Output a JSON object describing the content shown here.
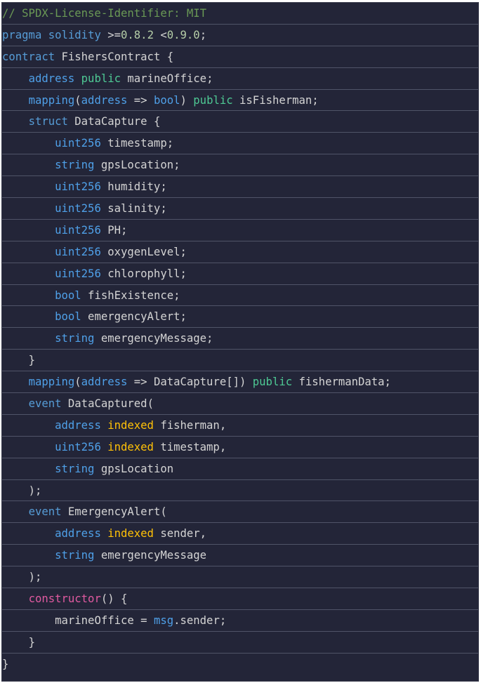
{
  "colors": {
    "background": "#232538",
    "line_separator": "#505468",
    "default": "#d4d4d4",
    "comment": "#6a9955",
    "keyword": "#569cd6",
    "type": "#4fa0e8",
    "modifier": "#4ec994",
    "indexed": "#ffc107",
    "number": "#b5cea8",
    "function": "#e05aa0"
  },
  "code": {
    "lines": [
      {
        "indent": "",
        "tokens": [
          {
            "t": "// SPDX-License-Identifier: MIT",
            "c": "comment"
          }
        ]
      },
      {
        "indent": "",
        "tokens": [
          {
            "t": "pragma",
            "c": "keyword"
          },
          {
            "t": " "
          },
          {
            "t": "solidity",
            "c": "keyword"
          },
          {
            "t": " >="
          },
          {
            "t": "0.8.2",
            "c": "number"
          },
          {
            "t": " <"
          },
          {
            "t": "0.9.0",
            "c": "number"
          },
          {
            "t": ";"
          }
        ]
      },
      {
        "indent": "",
        "tokens": [
          {
            "t": "contract",
            "c": "keyword"
          },
          {
            "t": " FishersContract {"
          }
        ]
      },
      {
        "indent": "    ",
        "tokens": [
          {
            "t": "address",
            "c": "type"
          },
          {
            "t": " "
          },
          {
            "t": "public",
            "c": "modifier"
          },
          {
            "t": " marineOffice;"
          }
        ]
      },
      {
        "indent": "    ",
        "tokens": [
          {
            "t": "mapping",
            "c": "type"
          },
          {
            "t": "("
          },
          {
            "t": "address",
            "c": "type"
          },
          {
            "t": " => "
          },
          {
            "t": "bool",
            "c": "type"
          },
          {
            "t": ") "
          },
          {
            "t": "public",
            "c": "modifier"
          },
          {
            "t": " isFisherman;"
          }
        ]
      },
      {
        "indent": "    ",
        "tokens": [
          {
            "t": "struct",
            "c": "keyword"
          },
          {
            "t": " DataCapture {"
          }
        ]
      },
      {
        "indent": "        ",
        "tokens": [
          {
            "t": "uint256",
            "c": "type"
          },
          {
            "t": " timestamp;"
          }
        ]
      },
      {
        "indent": "        ",
        "tokens": [
          {
            "t": "string",
            "c": "type"
          },
          {
            "t": " gpsLocation;"
          }
        ]
      },
      {
        "indent": "        ",
        "tokens": [
          {
            "t": "uint256",
            "c": "type"
          },
          {
            "t": " humidity;"
          }
        ]
      },
      {
        "indent": "        ",
        "tokens": [
          {
            "t": "uint256",
            "c": "type"
          },
          {
            "t": " salinity;"
          }
        ]
      },
      {
        "indent": "        ",
        "tokens": [
          {
            "t": "uint256",
            "c": "type"
          },
          {
            "t": " PH;"
          }
        ]
      },
      {
        "indent": "        ",
        "tokens": [
          {
            "t": "uint256",
            "c": "type"
          },
          {
            "t": " oxygenLevel;"
          }
        ]
      },
      {
        "indent": "        ",
        "tokens": [
          {
            "t": "uint256",
            "c": "type"
          },
          {
            "t": " chlorophyll;"
          }
        ]
      },
      {
        "indent": "        ",
        "tokens": [
          {
            "t": "bool",
            "c": "type"
          },
          {
            "t": " fishExistence;"
          }
        ]
      },
      {
        "indent": "        ",
        "tokens": [
          {
            "t": "bool",
            "c": "type"
          },
          {
            "t": " emergencyAlert;"
          }
        ]
      },
      {
        "indent": "        ",
        "tokens": [
          {
            "t": "string",
            "c": "type"
          },
          {
            "t": " emergencyMessage;"
          }
        ]
      },
      {
        "indent": "    ",
        "tokens": [
          {
            "t": "}"
          }
        ]
      },
      {
        "indent": "    ",
        "tokens": [
          {
            "t": "mapping",
            "c": "type"
          },
          {
            "t": "("
          },
          {
            "t": "address",
            "c": "type"
          },
          {
            "t": " => DataCapture[]) "
          },
          {
            "t": "public",
            "c": "modifier"
          },
          {
            "t": " fishermanData;"
          }
        ]
      },
      {
        "indent": "    ",
        "tokens": [
          {
            "t": "event",
            "c": "keyword"
          },
          {
            "t": " DataCaptured("
          }
        ]
      },
      {
        "indent": "        ",
        "tokens": [
          {
            "t": "address",
            "c": "type"
          },
          {
            "t": " "
          },
          {
            "t": "indexed",
            "c": "indexed"
          },
          {
            "t": " fisherman,"
          }
        ]
      },
      {
        "indent": "        ",
        "tokens": [
          {
            "t": "uint256",
            "c": "type"
          },
          {
            "t": " "
          },
          {
            "t": "indexed",
            "c": "indexed"
          },
          {
            "t": " timestamp,"
          }
        ]
      },
      {
        "indent": "        ",
        "tokens": [
          {
            "t": "string",
            "c": "type"
          },
          {
            "t": " gpsLocation"
          }
        ]
      },
      {
        "indent": "    ",
        "tokens": [
          {
            "t": ");"
          }
        ]
      },
      {
        "indent": "    ",
        "tokens": [
          {
            "t": "event",
            "c": "keyword"
          },
          {
            "t": " EmergencyAlert("
          }
        ]
      },
      {
        "indent": "        ",
        "tokens": [
          {
            "t": "address",
            "c": "type"
          },
          {
            "t": " "
          },
          {
            "t": "indexed",
            "c": "indexed"
          },
          {
            "t": " sender,"
          }
        ]
      },
      {
        "indent": "        ",
        "tokens": [
          {
            "t": "string",
            "c": "type"
          },
          {
            "t": " emergencyMessage"
          }
        ]
      },
      {
        "indent": "    ",
        "tokens": [
          {
            "t": ");"
          }
        ]
      },
      {
        "indent": "    ",
        "tokens": [
          {
            "t": "constructor",
            "c": "function"
          },
          {
            "t": "() {"
          }
        ]
      },
      {
        "indent": "        ",
        "tokens": [
          {
            "t": "marineOffice = "
          },
          {
            "t": "msg",
            "c": "type"
          },
          {
            "t": ".sender;"
          }
        ]
      },
      {
        "indent": "    ",
        "tokens": [
          {
            "t": "}"
          }
        ]
      },
      {
        "indent": "",
        "tokens": [
          {
            "t": "}"
          }
        ]
      }
    ]
  }
}
